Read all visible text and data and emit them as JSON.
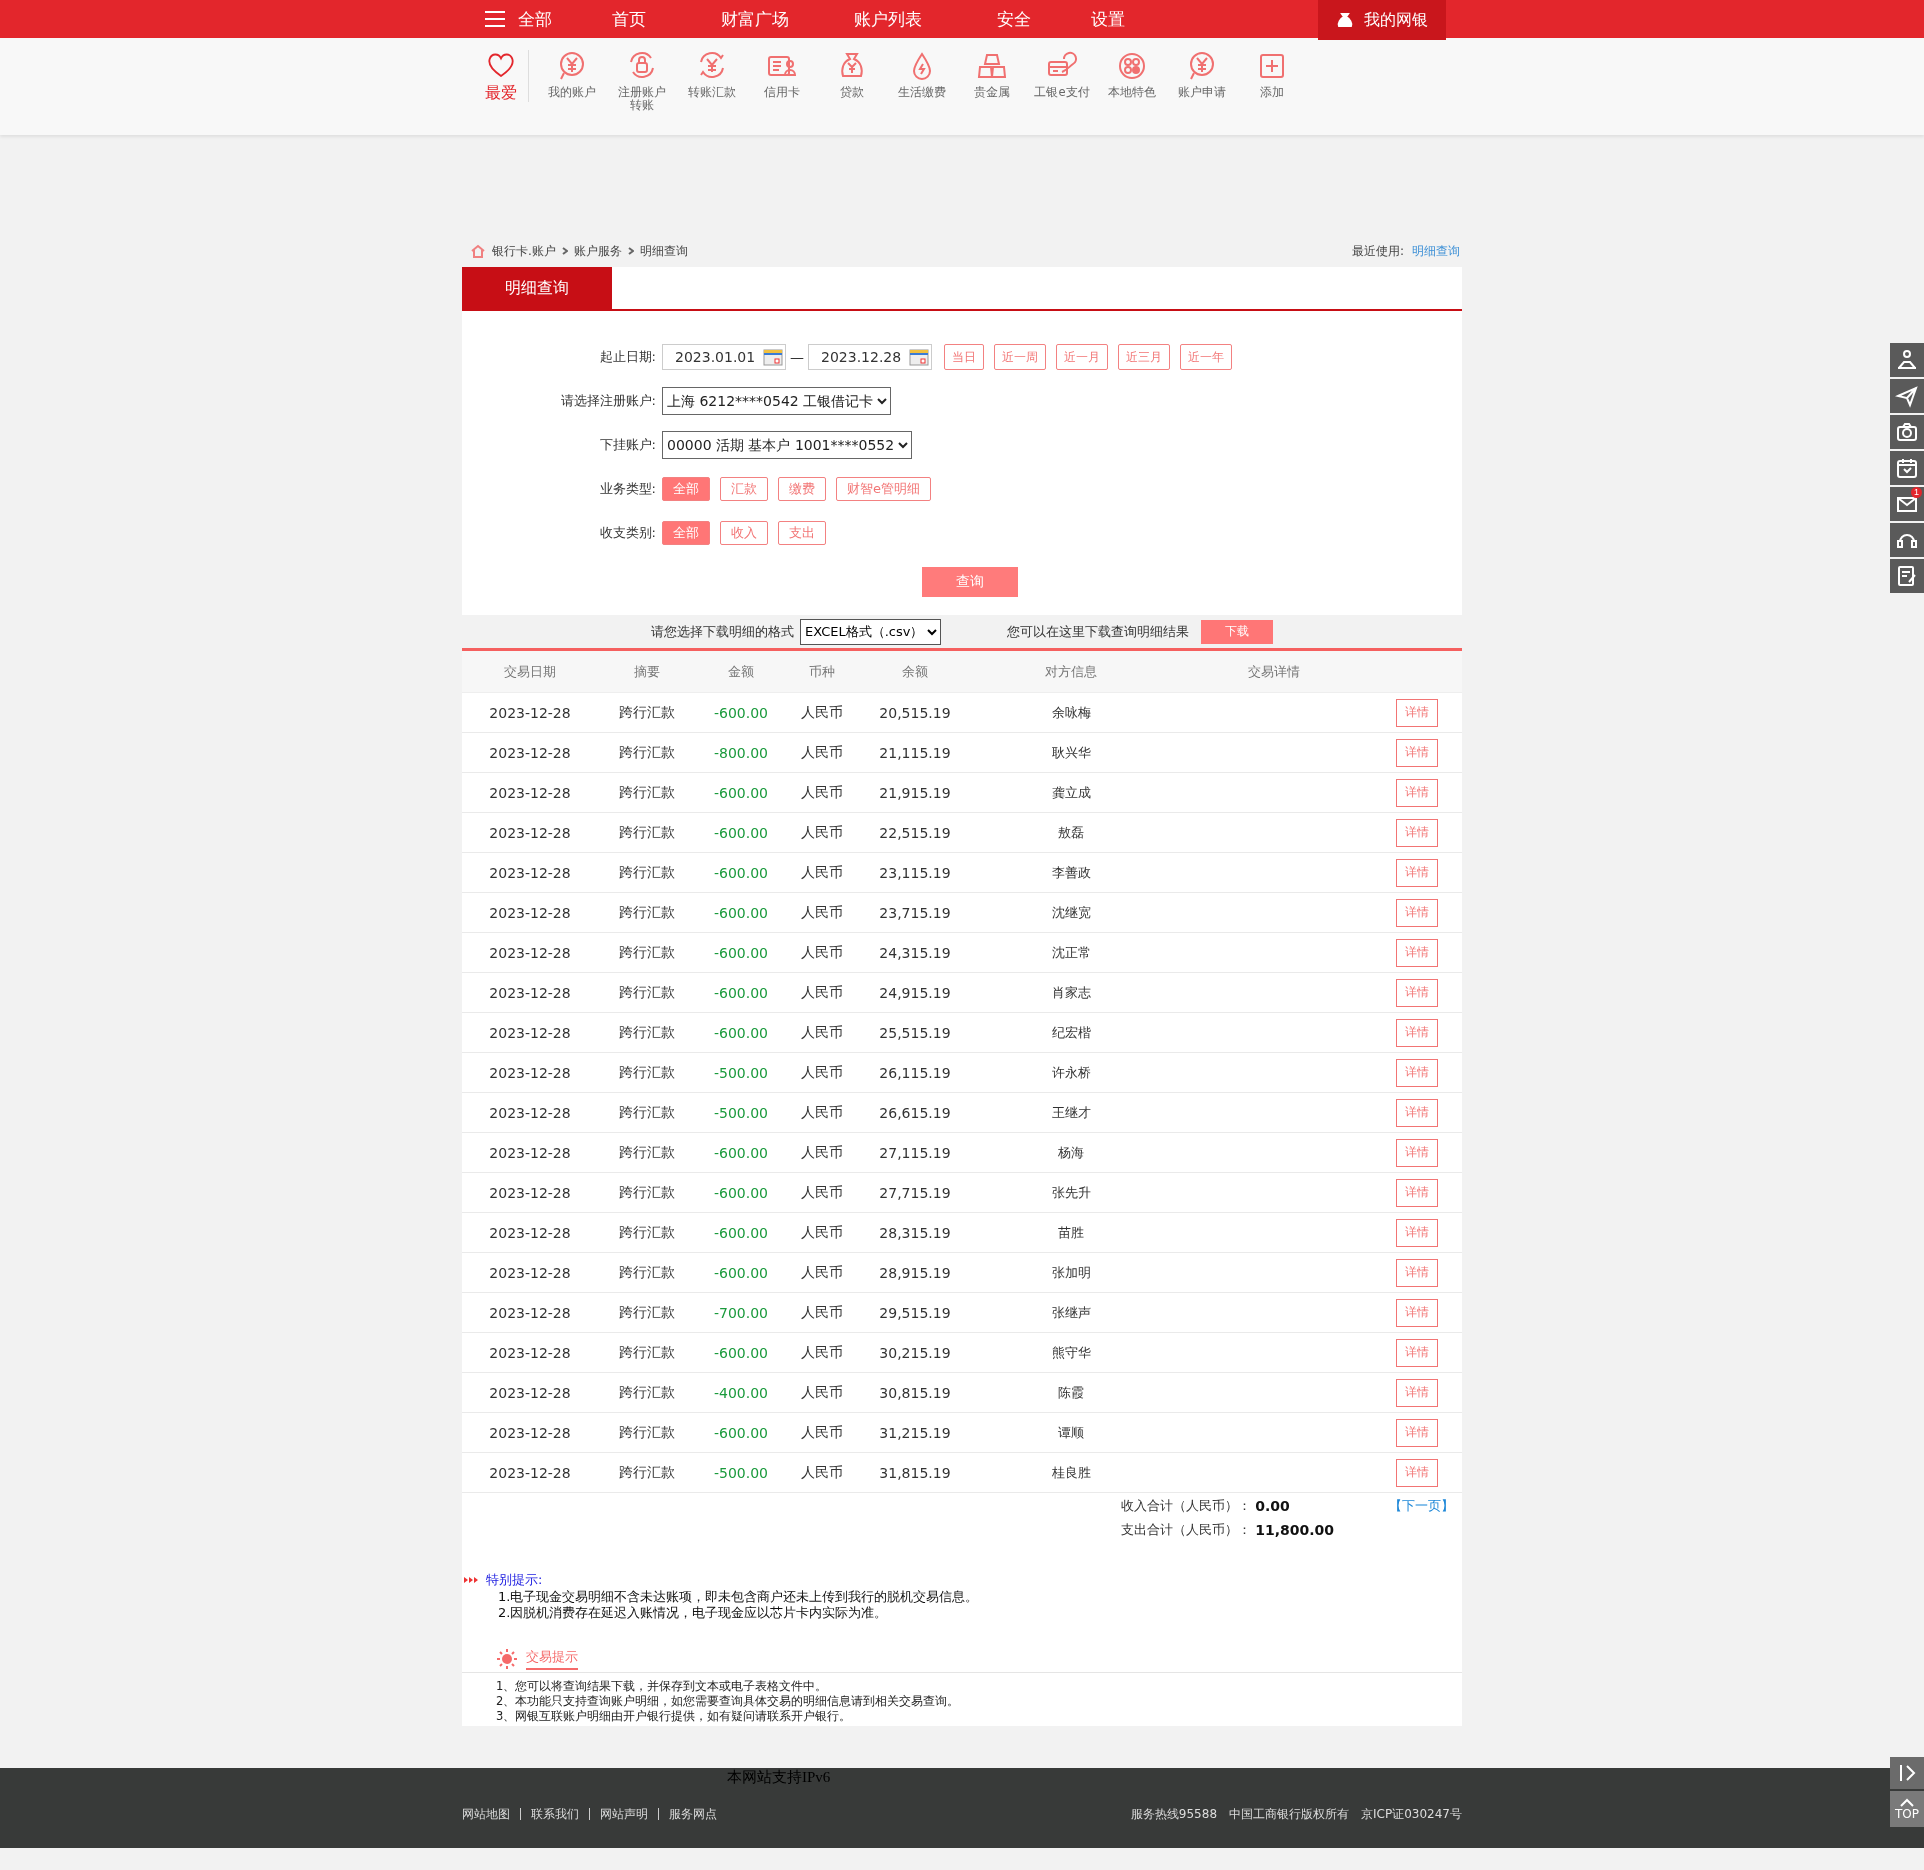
{
  "top_nav": {
    "menu_label": "全部",
    "items": [
      {
        "label": "首页"
      },
      {
        "label": "财富广场"
      },
      {
        "label": "账户列表"
      },
      {
        "label": "安全"
      },
      {
        "label": "设置"
      }
    ],
    "my_bank": "我的网银"
  },
  "shortcuts": [
    {
      "label": "最爱",
      "selected": true
    },
    {
      "label": "我的账户",
      "selected": false
    },
    {
      "label": "注册账户转账",
      "selected": false
    },
    {
      "label": "转账汇款",
      "selected": false
    },
    {
      "label": "信用卡",
      "selected": false
    },
    {
      "label": "贷款",
      "selected": false
    },
    {
      "label": "生活缴费",
      "selected": false
    },
    {
      "label": "贵金属",
      "selected": false
    },
    {
      "label": "工银e支付",
      "selected": false
    },
    {
      "label": "本地特色",
      "selected": false
    },
    {
      "label": "账户申请",
      "selected": false
    },
    {
      "label": "添加",
      "selected": false
    }
  ],
  "breadcrumb": [
    "银行卡.账户",
    "账户服务",
    "明细查询"
  ],
  "recent": {
    "label": "最近使用:",
    "link": "明细查询"
  },
  "tab": {
    "label": "明细查询",
    "selected": true
  },
  "form": {
    "date_label": "起止日期:",
    "date_from": "2023.01.01",
    "date_dash": "—",
    "date_to": "2023.12.28",
    "presets": [
      {
        "label": "当日",
        "selected": false
      },
      {
        "label": "近一周",
        "selected": false
      },
      {
        "label": "近一月",
        "selected": false
      },
      {
        "label": "近三月",
        "selected": false
      },
      {
        "label": "近一年",
        "selected": false
      }
    ],
    "account_label": "请选择注册账户:",
    "account": "上海 6212****0542 工银借记卡",
    "sub_account_label": "下挂账户:",
    "sub_account": "00000 活期 基本户 1001****0552",
    "business_label": "业务类型:",
    "business_types": [
      {
        "label": "全部",
        "selected": true
      },
      {
        "label": "汇款",
        "selected": false
      },
      {
        "label": "缴费",
        "selected": false
      },
      {
        "label": "财智e管明细",
        "selected": false
      }
    ],
    "flow_label": "收支类别:",
    "flow_types": [
      {
        "label": "全部",
        "selected": true
      },
      {
        "label": "收入",
        "selected": false
      },
      {
        "label": "支出",
        "selected": false
      }
    ],
    "query_button": "查询"
  },
  "download": {
    "label": "请您选择下载明细的格式",
    "format": "EXCEL格式（.csv）",
    "hint": "您可以在这里下载查询明细结果",
    "button": "下载"
  },
  "table": {
    "columns": [
      "交易日期",
      "摘要",
      "金额",
      "币种",
      "余额",
      "对方信息",
      "交易详情"
    ],
    "rows": [
      {
        "date": "2023-12-28",
        "summary": "跨行汇款",
        "amount": "-600.00",
        "currency": "人民币",
        "balance": "20,515.19",
        "counterparty": "余咏梅",
        "detail": "详情"
      },
      {
        "date": "2023-12-28",
        "summary": "跨行汇款",
        "amount": "-800.00",
        "currency": "人民币",
        "balance": "21,115.19",
        "counterparty": "耿兴华",
        "detail": "详情"
      },
      {
        "date": "2023-12-28",
        "summary": "跨行汇款",
        "amount": "-600.00",
        "currency": "人民币",
        "balance": "21,915.19",
        "counterparty": "龚立成",
        "detail": "详情"
      },
      {
        "date": "2023-12-28",
        "summary": "跨行汇款",
        "amount": "-600.00",
        "currency": "人民币",
        "balance": "22,515.19",
        "counterparty": "敖磊",
        "detail": "详情"
      },
      {
        "date": "2023-12-28",
        "summary": "跨行汇款",
        "amount": "-600.00",
        "currency": "人民币",
        "balance": "23,115.19",
        "counterparty": "李善政",
        "detail": "详情"
      },
      {
        "date": "2023-12-28",
        "summary": "跨行汇款",
        "amount": "-600.00",
        "currency": "人民币",
        "balance": "23,715.19",
        "counterparty": "沈继宽",
        "detail": "详情"
      },
      {
        "date": "2023-12-28",
        "summary": "跨行汇款",
        "amount": "-600.00",
        "currency": "人民币",
        "balance": "24,315.19",
        "counterparty": "沈正常",
        "detail": "详情"
      },
      {
        "date": "2023-12-28",
        "summary": "跨行汇款",
        "amount": "-600.00",
        "currency": "人民币",
        "balance": "24,915.19",
        "counterparty": "肖家志",
        "detail": "详情"
      },
      {
        "date": "2023-12-28",
        "summary": "跨行汇款",
        "amount": "-600.00",
        "currency": "人民币",
        "balance": "25,515.19",
        "counterparty": "纪宏楷",
        "detail": "详情"
      },
      {
        "date": "2023-12-28",
        "summary": "跨行汇款",
        "amount": "-500.00",
        "currency": "人民币",
        "balance": "26,115.19",
        "counterparty": "许永桥",
        "detail": "详情"
      },
      {
        "date": "2023-12-28",
        "summary": "跨行汇款",
        "amount": "-500.00",
        "currency": "人民币",
        "balance": "26,615.19",
        "counterparty": "王继才",
        "detail": "详情"
      },
      {
        "date": "2023-12-28",
        "summary": "跨行汇款",
        "amount": "-600.00",
        "currency": "人民币",
        "balance": "27,115.19",
        "counterparty": "杨海",
        "detail": "详情"
      },
      {
        "date": "2023-12-28",
        "summary": "跨行汇款",
        "amount": "-600.00",
        "currency": "人民币",
        "balance": "27,715.19",
        "counterparty": "张先升",
        "detail": "详情"
      },
      {
        "date": "2023-12-28",
        "summary": "跨行汇款",
        "amount": "-600.00",
        "currency": "人民币",
        "balance": "28,315.19",
        "counterparty": "苗胜",
        "detail": "详情"
      },
      {
        "date": "2023-12-28",
        "summary": "跨行汇款",
        "amount": "-600.00",
        "currency": "人民币",
        "balance": "28,915.19",
        "counterparty": "张加明",
        "detail": "详情"
      },
      {
        "date": "2023-12-28",
        "summary": "跨行汇款",
        "amount": "-700.00",
        "currency": "人民币",
        "balance": "29,515.19",
        "counterparty": "张继声",
        "detail": "详情"
      },
      {
        "date": "2023-12-28",
        "summary": "跨行汇款",
        "amount": "-600.00",
        "currency": "人民币",
        "balance": "30,215.19",
        "counterparty": "熊守华",
        "detail": "详情"
      },
      {
        "date": "2023-12-28",
        "summary": "跨行汇款",
        "amount": "-400.00",
        "currency": "人民币",
        "balance": "30,815.19",
        "counterparty": "陈霞",
        "detail": "详情"
      },
      {
        "date": "2023-12-28",
        "summary": "跨行汇款",
        "amount": "-600.00",
        "currency": "人民币",
        "balance": "31,215.19",
        "counterparty": "谭顺",
        "detail": "详情"
      },
      {
        "date": "2023-12-28",
        "summary": "跨行汇款",
        "amount": "-500.00",
        "currency": "人民币",
        "balance": "31,815.19",
        "counterparty": "桂良胜",
        "detail": "详情"
      }
    ]
  },
  "totals": {
    "income_label": "收入合计（人民币）：",
    "income": "0.00",
    "expense_label": "支出合计（人民币）：",
    "expense": "11,800.00",
    "next_page": "【下一页】"
  },
  "special_notice": {
    "title": "特别提示:",
    "lines": [
      "1.电子现金交易明细不含未达账项，即未包含商户还未上传到我行的脱机交易信息。",
      "2.因脱机消费存在延迟入账情况，电子现金应以芯片卡内实际为准。"
    ]
  },
  "tips": {
    "title": "交易提示",
    "lines": [
      "1、您可以将查询结果下载，并保存到文本或电子表格文件中。",
      "2、本功能只支持查询账户明细，如您需要查询具体交易的明细信息请到相关交易查询。",
      "3、网银互联账户明细由开户银行提供，如有疑问请联系开户银行。"
    ]
  },
  "mail_badge": "1",
  "footer": {
    "ipv6": "本网站支持IPv6",
    "links": [
      "网站地图",
      "联系我们",
      "网站声明",
      "服务网点"
    ],
    "info": [
      "服务热线95588",
      "中国工商银行版权所有",
      "京ICP证030247号"
    ],
    "top_button": "TOP"
  }
}
